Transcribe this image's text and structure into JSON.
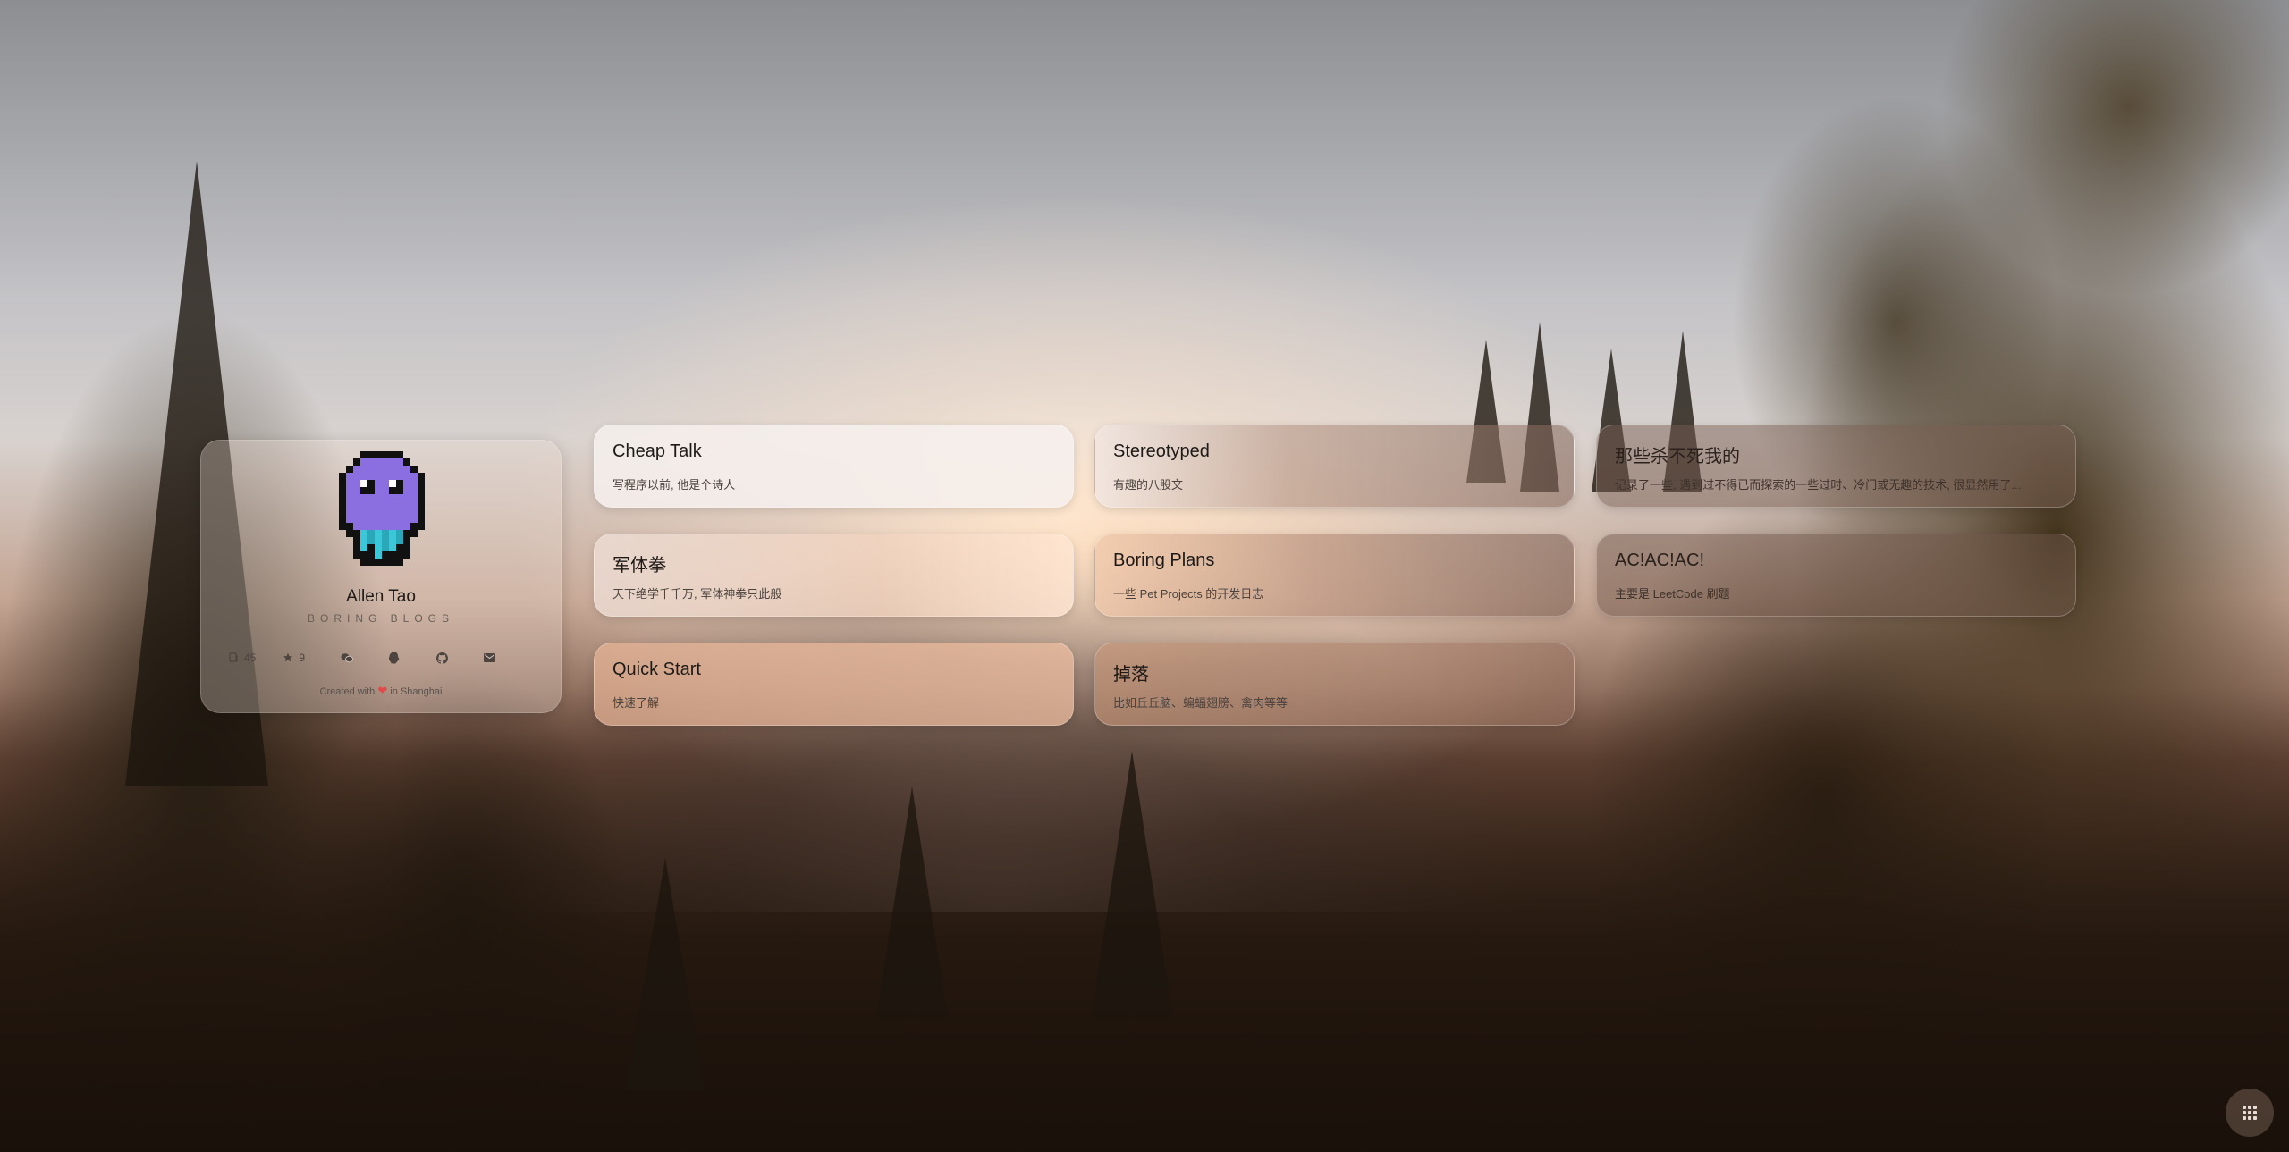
{
  "profile": {
    "name": "Allen Tao",
    "tagline": "BORING BLOGS",
    "post_count": "45",
    "star_count": "9",
    "footer_prefix": "Created with",
    "footer_suffix": "in Shanghai",
    "heart_color": "#e24a4a",
    "avatar_colors": {
      "body": "#8b6fe0",
      "outline": "#111111",
      "drip": "#3cc7d9"
    }
  },
  "social_icons": [
    "wechat-icon",
    "qq-icon",
    "github-icon",
    "email-icon"
  ],
  "cards": [
    {
      "title": "Cheap Talk",
      "desc": "写程序以前, 他是个诗人"
    },
    {
      "title": "Stereotyped",
      "desc": "有趣的八股文"
    },
    {
      "title": "那些杀不死我的",
      "desc": "记录了一些, 遇到过不得已而探索的一些过时、冷门或无趣的技术, 很显然用了..."
    },
    {
      "title": "军体拳",
      "desc": "天下绝学千千万, 军体神拳只此般"
    },
    {
      "title": "Boring Plans",
      "desc": "一些 Pet Projects 的开发日志"
    },
    {
      "title": "AC!AC!AC!",
      "desc": "主要是 LeetCode 刷题"
    },
    {
      "title": "Quick Start",
      "desc": "快速了解"
    },
    {
      "title": "掉落",
      "desc": "比如丘丘脑、蝙蝠翅膀、禽肉等等"
    }
  ],
  "launcher_icon": "grid-icon"
}
